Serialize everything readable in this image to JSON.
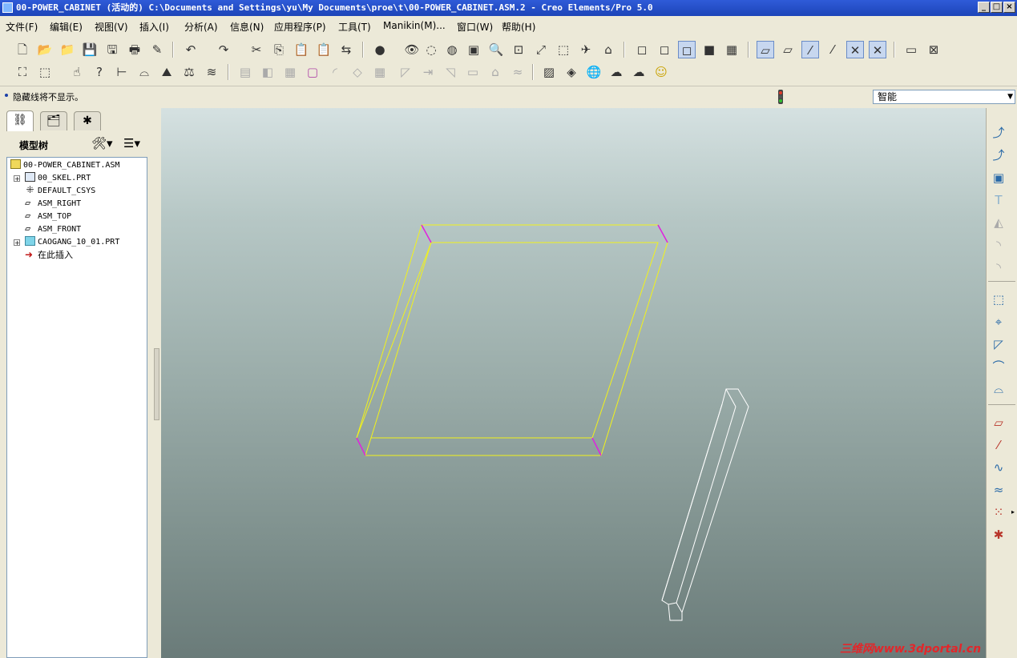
{
  "window": {
    "title": "00-POWER_CABINET (活动的) C:\\Documents and Settings\\yu\\My Documents\\proe\\t\\00-POWER_CABINET.ASM.2 - Creo Elements/Pro 5.0",
    "minimize_icon": "minimize-icon",
    "maximize_icon": "maximize-icon",
    "close_icon": "close-icon"
  },
  "menu": [
    {
      "label": "文件(F)"
    },
    {
      "label": "编辑(E)"
    },
    {
      "label": "视图(V)"
    },
    {
      "label": "插入(I)"
    },
    {
      "label": "分析(A)"
    },
    {
      "label": "信息(N)"
    },
    {
      "label": "应用程序(P)"
    },
    {
      "label": "工具(T)"
    },
    {
      "label": "Manikin(M)..."
    },
    {
      "label": "窗口(W)"
    },
    {
      "label": "帮助(H)"
    }
  ],
  "status": {
    "message": "隐藏线将不显示。",
    "filter_value": "智能"
  },
  "model_tree": {
    "tabs": [
      "model-tree-tab-icon",
      "folder-browser-tab-icon",
      "favorites-tab-icon"
    ],
    "title": "模型树",
    "items": [
      {
        "label": "00-POWER_CABINET.ASM",
        "icon": "assembly-icon",
        "expandable": false
      },
      {
        "label": "00_SKEL.PRT",
        "icon": "skeleton-part-icon",
        "expandable": true
      },
      {
        "label": "DEFAULT_CSYS",
        "icon": "csys-icon",
        "expandable": false
      },
      {
        "label": "ASM_RIGHT",
        "icon": "datum-plane-icon",
        "expandable": false
      },
      {
        "label": "ASM_TOP",
        "icon": "datum-plane-icon",
        "expandable": false
      },
      {
        "label": "ASM_FRONT",
        "icon": "datum-plane-icon",
        "expandable": false
      },
      {
        "label": "CAOGANG_10_01.PRT",
        "icon": "part-icon",
        "expandable": true
      },
      {
        "label": "在此插入",
        "icon": "insert-here-arrow-icon",
        "expandable": false
      }
    ]
  },
  "colors": {
    "frame_yellow": "#f2f21a",
    "frame_magenta": "#e020e0",
    "channel_white": "#ffffff",
    "title_blue": "#2350cc"
  },
  "watermark": "三维网www.3dportal.cn"
}
